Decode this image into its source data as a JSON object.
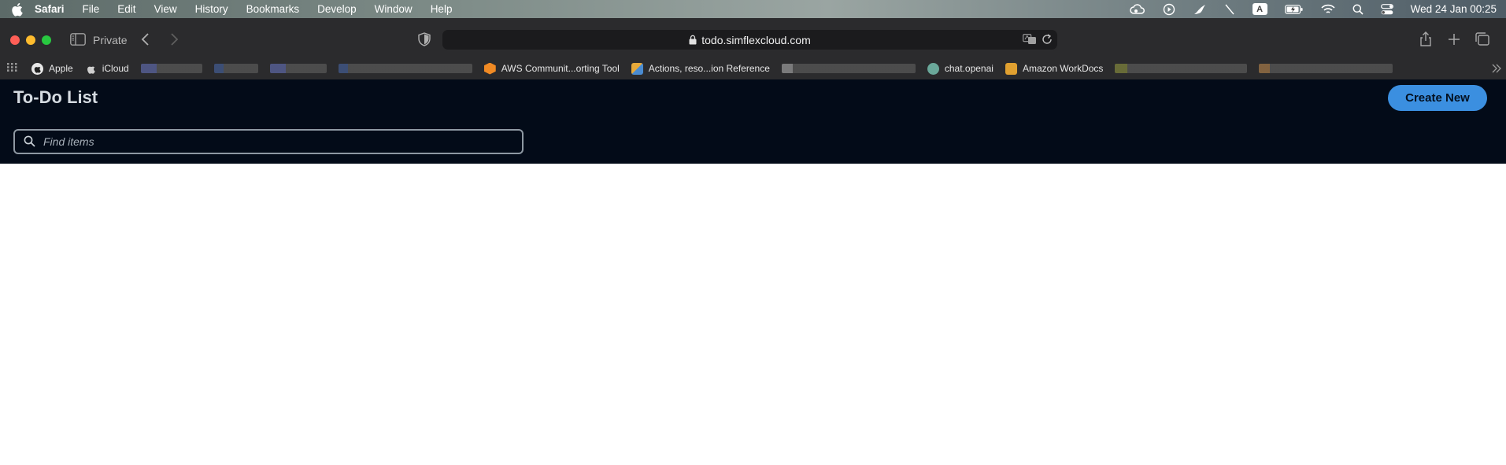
{
  "menubar": {
    "app_name": "Safari",
    "items": [
      "File",
      "Edit",
      "View",
      "History",
      "Bookmarks",
      "Develop",
      "Window",
      "Help"
    ],
    "status_icons": [
      "creative-cloud-icon",
      "play-circle-icon",
      "bird-icon",
      "slash-icon",
      "input-source-icon",
      "battery-icon",
      "wifi-icon",
      "spotlight-icon",
      "control-center-icon"
    ],
    "input_source_letter": "A",
    "clock": "Wed 24 Jan  00:25"
  },
  "browser": {
    "mode_label": "Private",
    "url": "todo.simflexcloud.com",
    "bookmarks": [
      {
        "label": "Apple",
        "icon": "apple-icon"
      },
      {
        "label": "iCloud",
        "icon": "apple-icon"
      },
      {
        "label": "AWS Communit...orting Tool",
        "icon": "aws-icon"
      },
      {
        "label": "Actions, reso...ion Reference",
        "icon": "aws-icon"
      },
      {
        "label": "chat.openai",
        "icon": "openai-icon"
      },
      {
        "label": "Amazon WorkDocs",
        "icon": "workdocs-icon"
      }
    ]
  },
  "app": {
    "title": "To-Do List",
    "create_button": "Create New",
    "search_placeholder": "Find items",
    "accent": "#3b8fe0",
    "header_bg": "#030b18"
  }
}
